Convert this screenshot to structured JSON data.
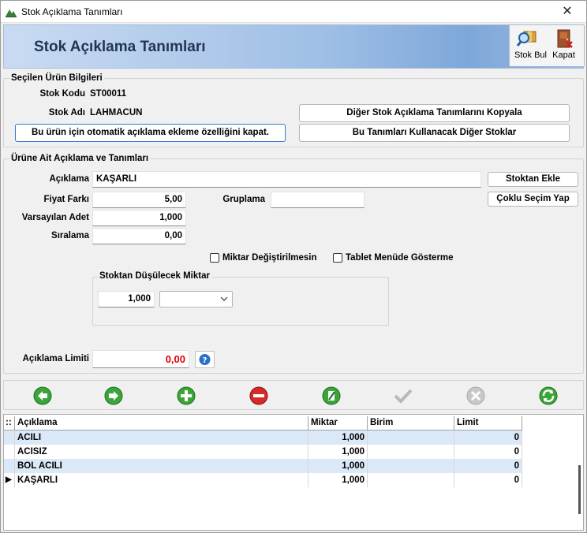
{
  "window": {
    "title": "Stok Açıklama Tanımları",
    "close_symbol": "✕"
  },
  "header": {
    "title": "Stok Açıklama Tanımları",
    "tools": [
      {
        "label": "Stok Bul",
        "icon": "search-product-icon"
      },
      {
        "label": "Kapat",
        "icon": "exit-door-icon"
      }
    ]
  },
  "product_info": {
    "group_title": "Seçilen Ürün Bilgileri",
    "code_label": "Stok Kodu",
    "code_value": "ST00011",
    "name_label": "Stok Adı",
    "name_value": "LAHMACUN",
    "auto_desc_button": "Bu ürün için otomatik açıklama ekleme özelliğini kapat.",
    "copy_button": "Diğer Stok Açıklama Tanımlarını Kopyala",
    "other_stocks_button": "Bu Tanımları Kullanacak Diğer Stoklar"
  },
  "definitions": {
    "group_title": "Ürüne Ait Açıklama ve Tanımları",
    "desc_label": "Açıklama",
    "desc_value": "KAŞARLI",
    "add_from_stock_button": "Stoktan Ekle",
    "multi_select_button": "Çoklu Seçim Yap",
    "price_diff_label": "Fiyat Farkı",
    "price_diff_value": "5,00",
    "grouping_label": "Gruplama",
    "grouping_value": "",
    "default_qty_label": "Varsayılan Adet",
    "default_qty_value": "1,000",
    "order_label": "Sıralama",
    "order_value": "0,00",
    "no_qty_change_label": "Miktar Değiştirilmesin",
    "no_qty_change_checked": false,
    "hide_tablet_label": "Tablet Menüde Gösterme",
    "hide_tablet_checked": false,
    "deduct_group_title": "Stoktan Düşülecek Miktar",
    "deduct_qty_value": "1,000",
    "deduct_unit_value": "",
    "limit_label": "Açıklama Limiti",
    "limit_value": "0,00",
    "limit_color": "#e00000"
  },
  "navbar": {
    "icons": [
      "prev-icon",
      "next-icon",
      "add-icon",
      "delete-icon",
      "edit-icon",
      "confirm-icon",
      "cancel-icon",
      "refresh-icon"
    ]
  },
  "grid": {
    "corner": "::",
    "columns": [
      "Açıklama",
      "Miktar",
      "Birim",
      "Limit"
    ],
    "rows": [
      {
        "aciklama": "ACILI",
        "miktar": "1,000",
        "birim": "",
        "limit": "0"
      },
      {
        "aciklama": "ACISIZ",
        "miktar": "1,000",
        "birim": "",
        "limit": "0"
      },
      {
        "aciklama": "BOL ACILI",
        "miktar": "1,000",
        "birim": "",
        "limit": "0"
      },
      {
        "aciklama": "KAŞARLI",
        "miktar": "1,000",
        "birim": "",
        "limit": "0"
      }
    ],
    "current_row_marker": "▶"
  }
}
